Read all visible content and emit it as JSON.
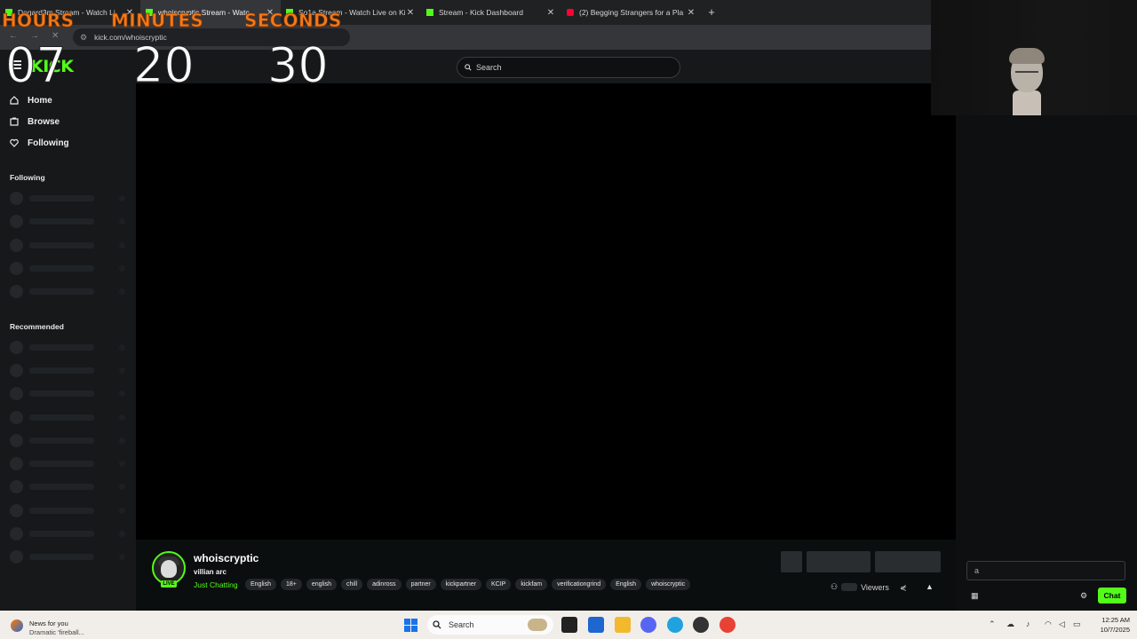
{
  "browser": {
    "tabs": [
      {
        "title": "Degard3m Stream - Watch Li",
        "favicon": "kick"
      },
      {
        "title": "whoiscryptic Stream - Watc",
        "favicon": "kick"
      },
      {
        "title": "So1a Stream - Watch Live on Ki",
        "favicon": "kick"
      },
      {
        "title": "Stream - Kick Dashboard",
        "favicon": "kick"
      },
      {
        "title": "(2) Begging Strangers for a Pla",
        "favicon": "youtube"
      }
    ],
    "new_tab": "+",
    "url": "kick.com/whoiscryptic"
  },
  "overlay": {
    "hours_label": "HOURS",
    "minutes_label": "MINUTES",
    "seconds_label": "SECONDS",
    "hours": "07",
    "minutes": "20",
    "seconds": "30",
    "label_color": "#f07a1a"
  },
  "kick": {
    "logo": "KICK",
    "search_placeholder": "Search",
    "nav": [
      {
        "label": "Home",
        "icon": "home-icon"
      },
      {
        "label": "Browse",
        "icon": "browse-icon"
      },
      {
        "label": "Following",
        "icon": "heart-icon"
      }
    ],
    "following_title": "Following",
    "recommended_title": "Recommended",
    "channel": {
      "name": "whoiscryptic",
      "stream_title": "villian arc",
      "category": "Just Chatting",
      "live_badge": "LIVE",
      "tags": [
        "English",
        "18+",
        "english",
        "chill",
        "adinross",
        "partner",
        "kickpartner",
        "KCIP",
        "kickfam",
        "verificationgrind",
        "English",
        "whoiscryptic"
      ]
    },
    "viewers_label": "Viewers",
    "chat_button": "Chat",
    "accent": "#53fc18"
  },
  "taskbar": {
    "news_title": "News for you",
    "news_sub": "Dramatic 'fireball...",
    "search": "Search",
    "time": "12:25 AM",
    "date": "10/7/2025"
  }
}
